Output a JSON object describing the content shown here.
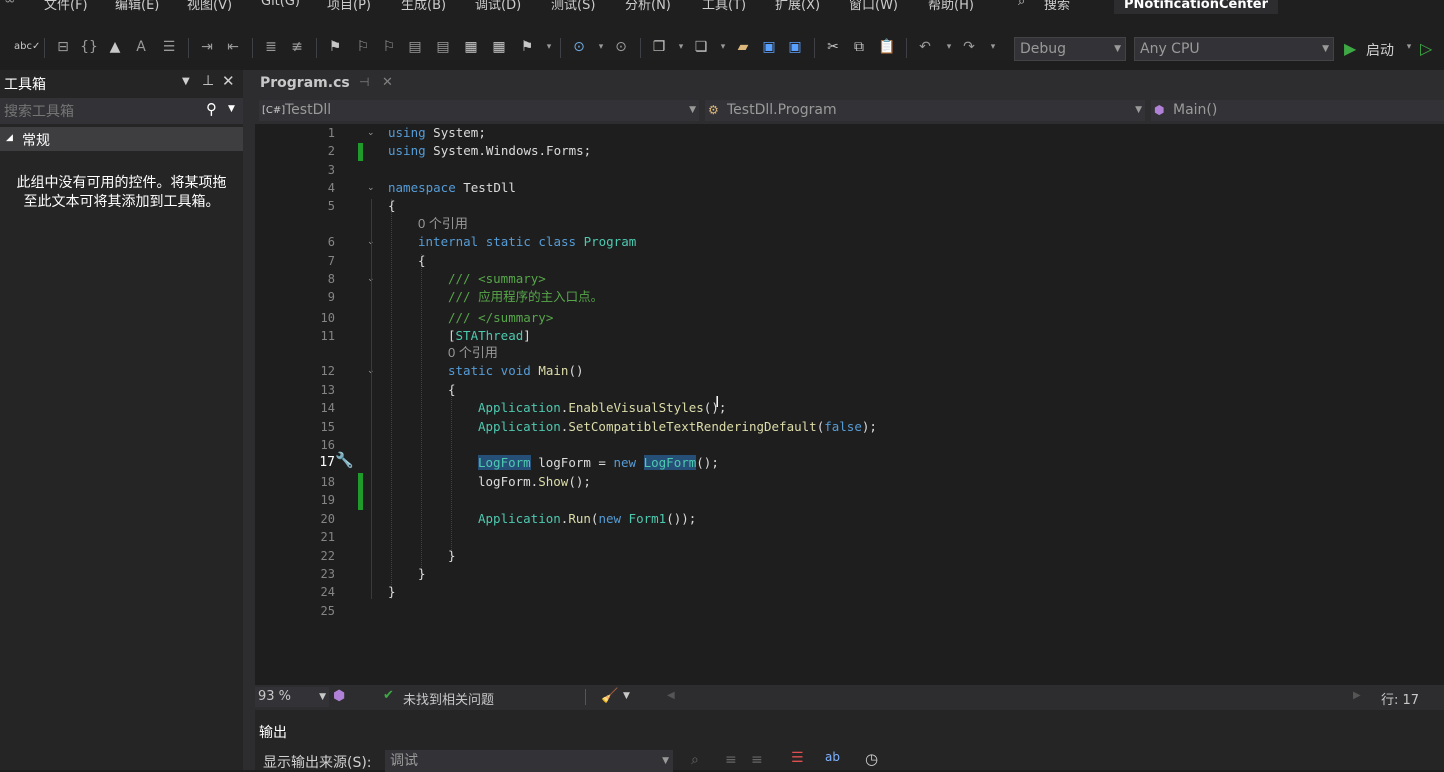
{
  "menu": [
    "文件(F)",
    "编辑(E)",
    "视图(V)",
    "Git(G)",
    "项目(P)",
    "生成(B)",
    "调试(D)",
    "测试(S)",
    "分析(N)",
    "工具(T)",
    "扩展(X)",
    "窗口(W)",
    "帮助(H)"
  ],
  "search_menu": "搜索",
  "solution_name": "PNotificationCenter",
  "toolbar": {
    "config": "Debug",
    "platform": "Any CPU",
    "start_label": "启动"
  },
  "toolbox": {
    "title": "工具箱",
    "search_placeholder": "搜索工具箱",
    "group": "常规",
    "empty_message": "此组中没有可用的控件。将某项拖至此文本可将其添加到工具箱。"
  },
  "tab": {
    "filename": "Program.cs"
  },
  "nav": {
    "project": "TestDll",
    "class": "TestDll.Program",
    "member": "Main()"
  },
  "code": {
    "ref_count": "0 个引用",
    "summary_text": "应用程序的主入口点。"
  },
  "current_line": "17",
  "status": {
    "zoom": "93 %",
    "issues": "未找到相关问题",
    "line_label": "行: 17"
  },
  "output": {
    "title": "输出",
    "source_label": "显示输出来源(S):",
    "source_value": "调试"
  },
  "colors": {
    "accent_green": "#1f9a2b",
    "keyword": "#569cd6",
    "type": "#4ec9b0",
    "method": "#dcdcaa",
    "comment": "#57a64a"
  }
}
